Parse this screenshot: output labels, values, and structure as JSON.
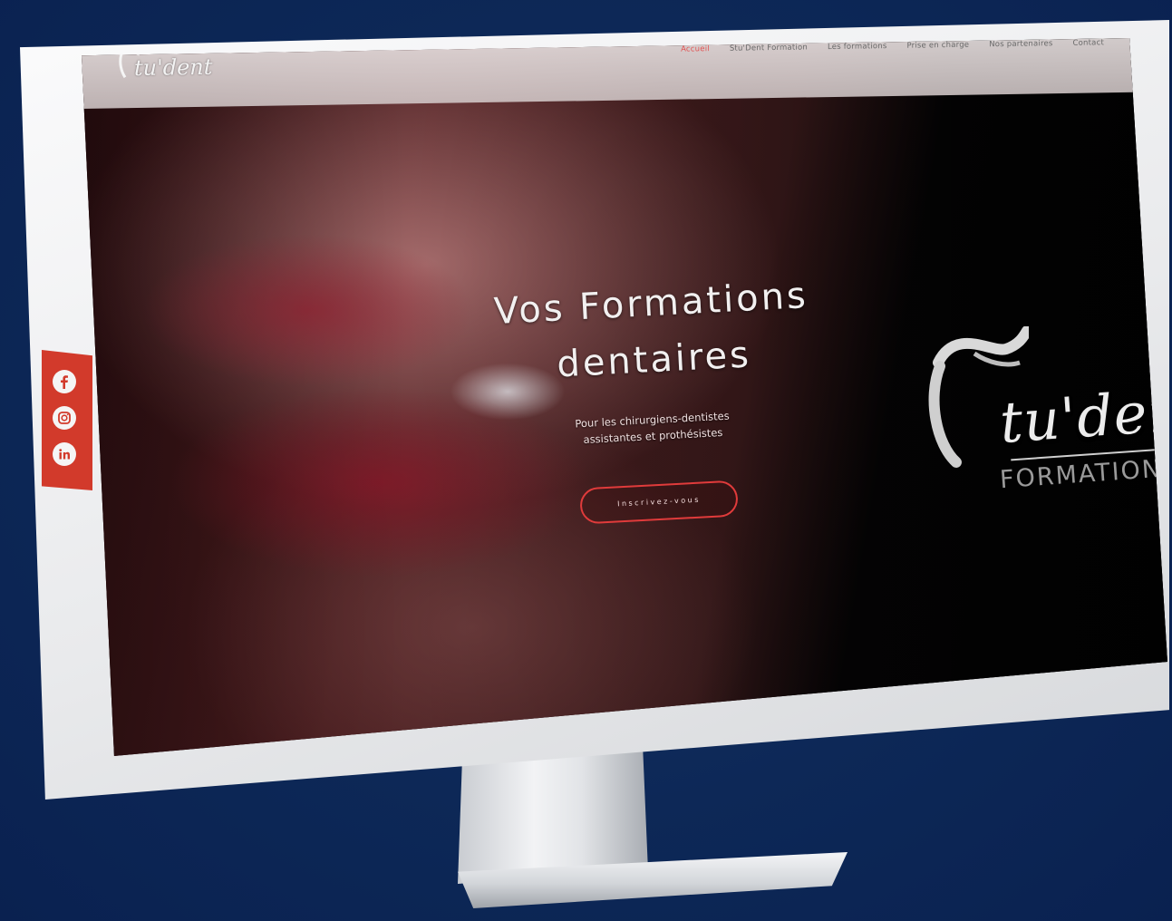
{
  "nav": {
    "logo_text": "tu'dent",
    "items": [
      {
        "label": "Accueil",
        "active": true
      },
      {
        "label": "Stu'Dent Formation",
        "active": false
      },
      {
        "label": "Les formations",
        "active": false
      },
      {
        "label": "Prise en charge",
        "active": false
      },
      {
        "label": "Nos partenaires",
        "active": false
      },
      {
        "label": "Contact",
        "active": false
      }
    ]
  },
  "hero": {
    "title_line1": "Vos Formations",
    "title_line2": "dentaires",
    "subtitle_line1": "Pour les chirurgiens-dentistes",
    "subtitle_line2": "assistantes et prothésistes",
    "cta_label": "Inscrivez-vous"
  },
  "brand": {
    "script_text": "tu'dent",
    "sub_text": "FORMATION"
  },
  "social": {
    "icons": [
      "facebook-icon",
      "instagram-icon",
      "linkedin-icon"
    ]
  },
  "colors": {
    "background": "#0d2857",
    "accent_red": "#d23a2b",
    "nav_active": "#e25555"
  }
}
